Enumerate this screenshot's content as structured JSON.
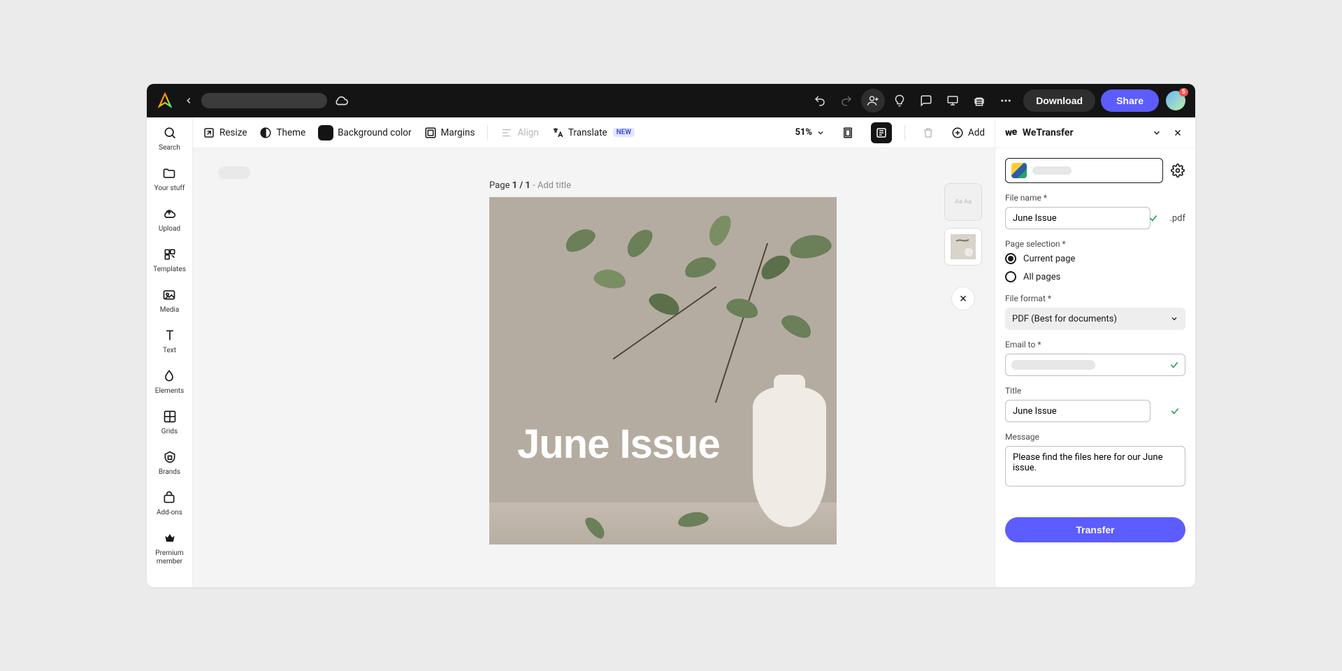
{
  "topbar": {
    "download_label": "Download",
    "share_label": "Share",
    "notification_count": "5"
  },
  "leftnav": {
    "items": [
      {
        "label": "Search"
      },
      {
        "label": "Your stuff"
      },
      {
        "label": "Upload"
      },
      {
        "label": "Templates"
      },
      {
        "label": "Media"
      },
      {
        "label": "Text"
      },
      {
        "label": "Elements"
      },
      {
        "label": "Grids"
      },
      {
        "label": "Brands"
      },
      {
        "label": "Add-ons"
      },
      {
        "label": "Premium member"
      }
    ]
  },
  "toolbar": {
    "resize": "Resize",
    "theme": "Theme",
    "bgcolor": "Background color",
    "margins": "Margins",
    "align": "Align",
    "translate": "Translate",
    "new_badge": "NEW",
    "zoom": "51%",
    "add": "Add"
  },
  "canvas": {
    "page_label_a": "Page ",
    "page_label_b": "1 / 1",
    "page_label_c": " - Add title",
    "artwork_title": "June Issue"
  },
  "panel": {
    "title": "WeTransfer",
    "file_name_label": "File name",
    "file_name_value": "June Issue",
    "file_ext": ".pdf",
    "page_selection_label": "Page selection",
    "radio_current": "Current page",
    "radio_all": "All pages",
    "file_format_label": "File format",
    "file_format_value": "PDF (Best for documents)",
    "email_to_label": "Email to",
    "title_label": "Title",
    "title_value": "June Issue",
    "message_label": "Message",
    "message_value": "Please find the files here for our June issue.",
    "transfer_btn": "Transfer"
  }
}
